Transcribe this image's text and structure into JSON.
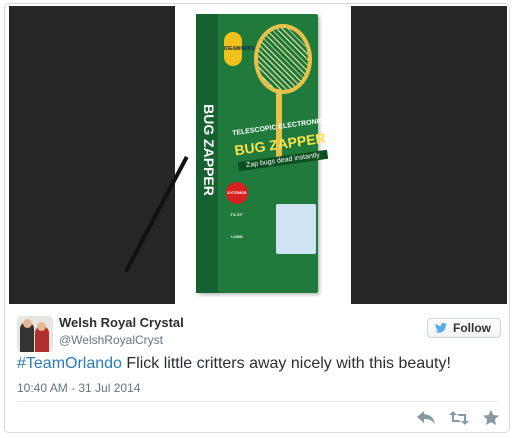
{
  "tweet": {
    "author_name": "Welsh Royal Crystal",
    "author_handle": "@WelshRoyalCryst",
    "hashtag": "#TeamOrlando",
    "text": " Flick little critters away nicely with this beauty!",
    "timestamp": "10:40 AM - 31 Jul 2014"
  },
  "follow_button": {
    "label": "Follow",
    "icon": "twitter-bird-icon"
  },
  "product_image": {
    "brand": "IDEAWORKS",
    "side_label": "BUG ZAPPER",
    "title_top": "TELESCOPIC ELECTRONIC",
    "title_main": "BUG ZAPPER",
    "tagline": "Zap bugs dead instantly",
    "badge": "EXTENDS TO 37\" LONG"
  },
  "actions": [
    {
      "icon": "reply-icon"
    },
    {
      "icon": "retweet-icon"
    },
    {
      "icon": "favorite-star-icon"
    }
  ],
  "colors": {
    "media_background": "#262626",
    "box_green": "#1f7a3c",
    "hashtag_blue": "#2b7bb9",
    "icon_gray": "#8899a6"
  }
}
